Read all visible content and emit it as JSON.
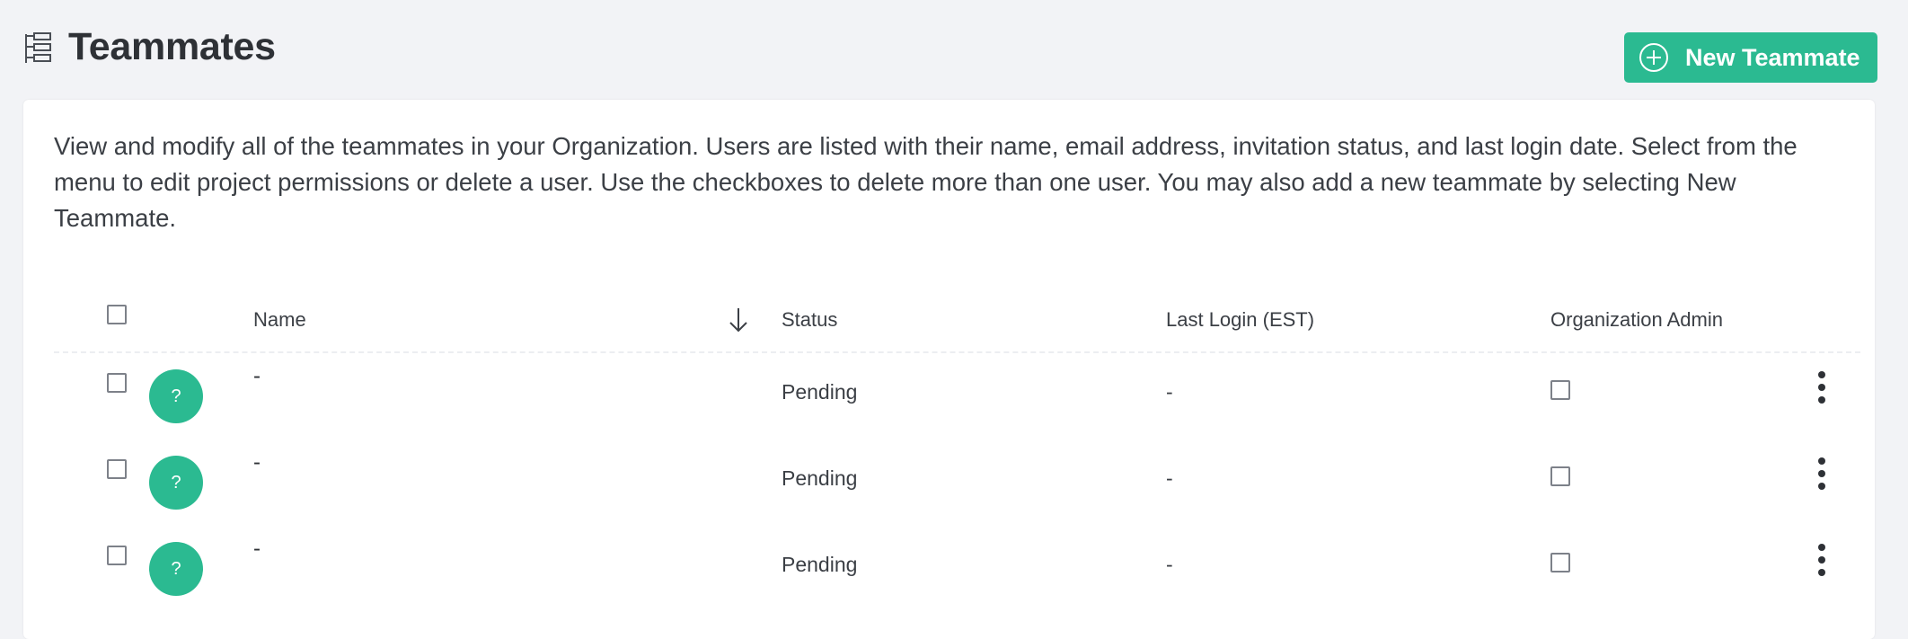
{
  "page": {
    "title": "Teammates",
    "header_icon": "hierarchy-list-icon"
  },
  "new_teammate_button": {
    "label": "New Teammate",
    "icon": "plus-circle-icon",
    "color": "#2bba91"
  },
  "description": "View and modify all of the teammates in your Organization. Users are listed with their name, email address, invitation status, and last login date. Select from the menu to edit project permissions or delete a user. Use the checkboxes to delete more than one user. You may also add a new teammate by selecting New Teammate.",
  "table": {
    "columns": {
      "name": "Name",
      "status": "Status",
      "last_login": "Last Login (EST)",
      "org_admin": "Organization Admin"
    },
    "sort_icon": "arrow-down-icon",
    "rows": [
      {
        "avatar": "?",
        "name": "-",
        "status": "Pending",
        "last_login": "-",
        "org_admin": false
      },
      {
        "avatar": "?",
        "name": "-",
        "status": "Pending",
        "last_login": "-",
        "org_admin": false
      },
      {
        "avatar": "?",
        "name": "-",
        "status": "Pending",
        "last_login": "-",
        "org_admin": false
      }
    ]
  }
}
